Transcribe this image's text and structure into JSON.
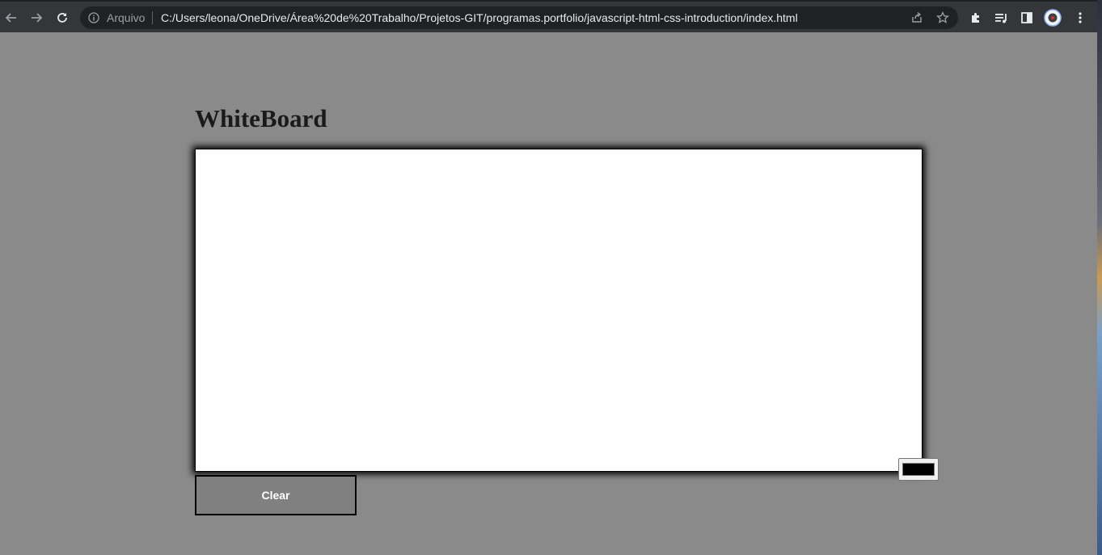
{
  "browser": {
    "scheme_label": "Arquivo",
    "url": "C:/Users/leona/OneDrive/Área%20de%20Trabalho/Projetos-GIT/programas.portfolio/javascript-html-css-introduction/index.html",
    "icons": {
      "back": "arrow-left-icon",
      "forward": "arrow-right-icon",
      "reload": "reload-icon",
      "info": "info-icon",
      "share": "share-icon",
      "bookmark": "star-icon",
      "extensions": "puzzle-icon",
      "media": "media-queue-icon",
      "side_panel": "side-panel-icon",
      "profile": "profile-avatar-icon",
      "menu": "kebab-menu-icon"
    }
  },
  "page": {
    "title": "WhiteBoard",
    "clear_label": "Clear",
    "pen_color": "#000000",
    "background_color": "#8a8a8a",
    "board_color": "#ffffff"
  }
}
